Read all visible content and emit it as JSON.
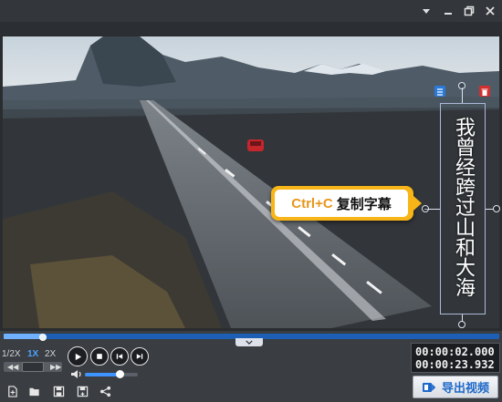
{
  "window": {
    "controls": [
      "dropdown-icon",
      "minimize-icon",
      "restore-icon",
      "close-icon"
    ]
  },
  "video": {
    "callout": {
      "shortcut": "Ctrl+C",
      "text": "复制字幕"
    },
    "subtitle": {
      "text": "我曾经跨过山和大海"
    }
  },
  "playback": {
    "progress": 0.08,
    "speeds": [
      "1/2X",
      "1X",
      "2X"
    ],
    "selected_speed": "1X",
    "volume": 0.65,
    "current_time": "00:00:02.000",
    "total_time": "00:00:23.932"
  },
  "toolbar": {
    "icons": [
      "new-file-icon",
      "open-folder-icon",
      "save-icon",
      "save-as-icon",
      "share-icon"
    ],
    "export_label": "导出视频"
  },
  "colors": {
    "accent": "#1d68c9",
    "callout": "#f7b518",
    "delete": "#d42f2f"
  }
}
